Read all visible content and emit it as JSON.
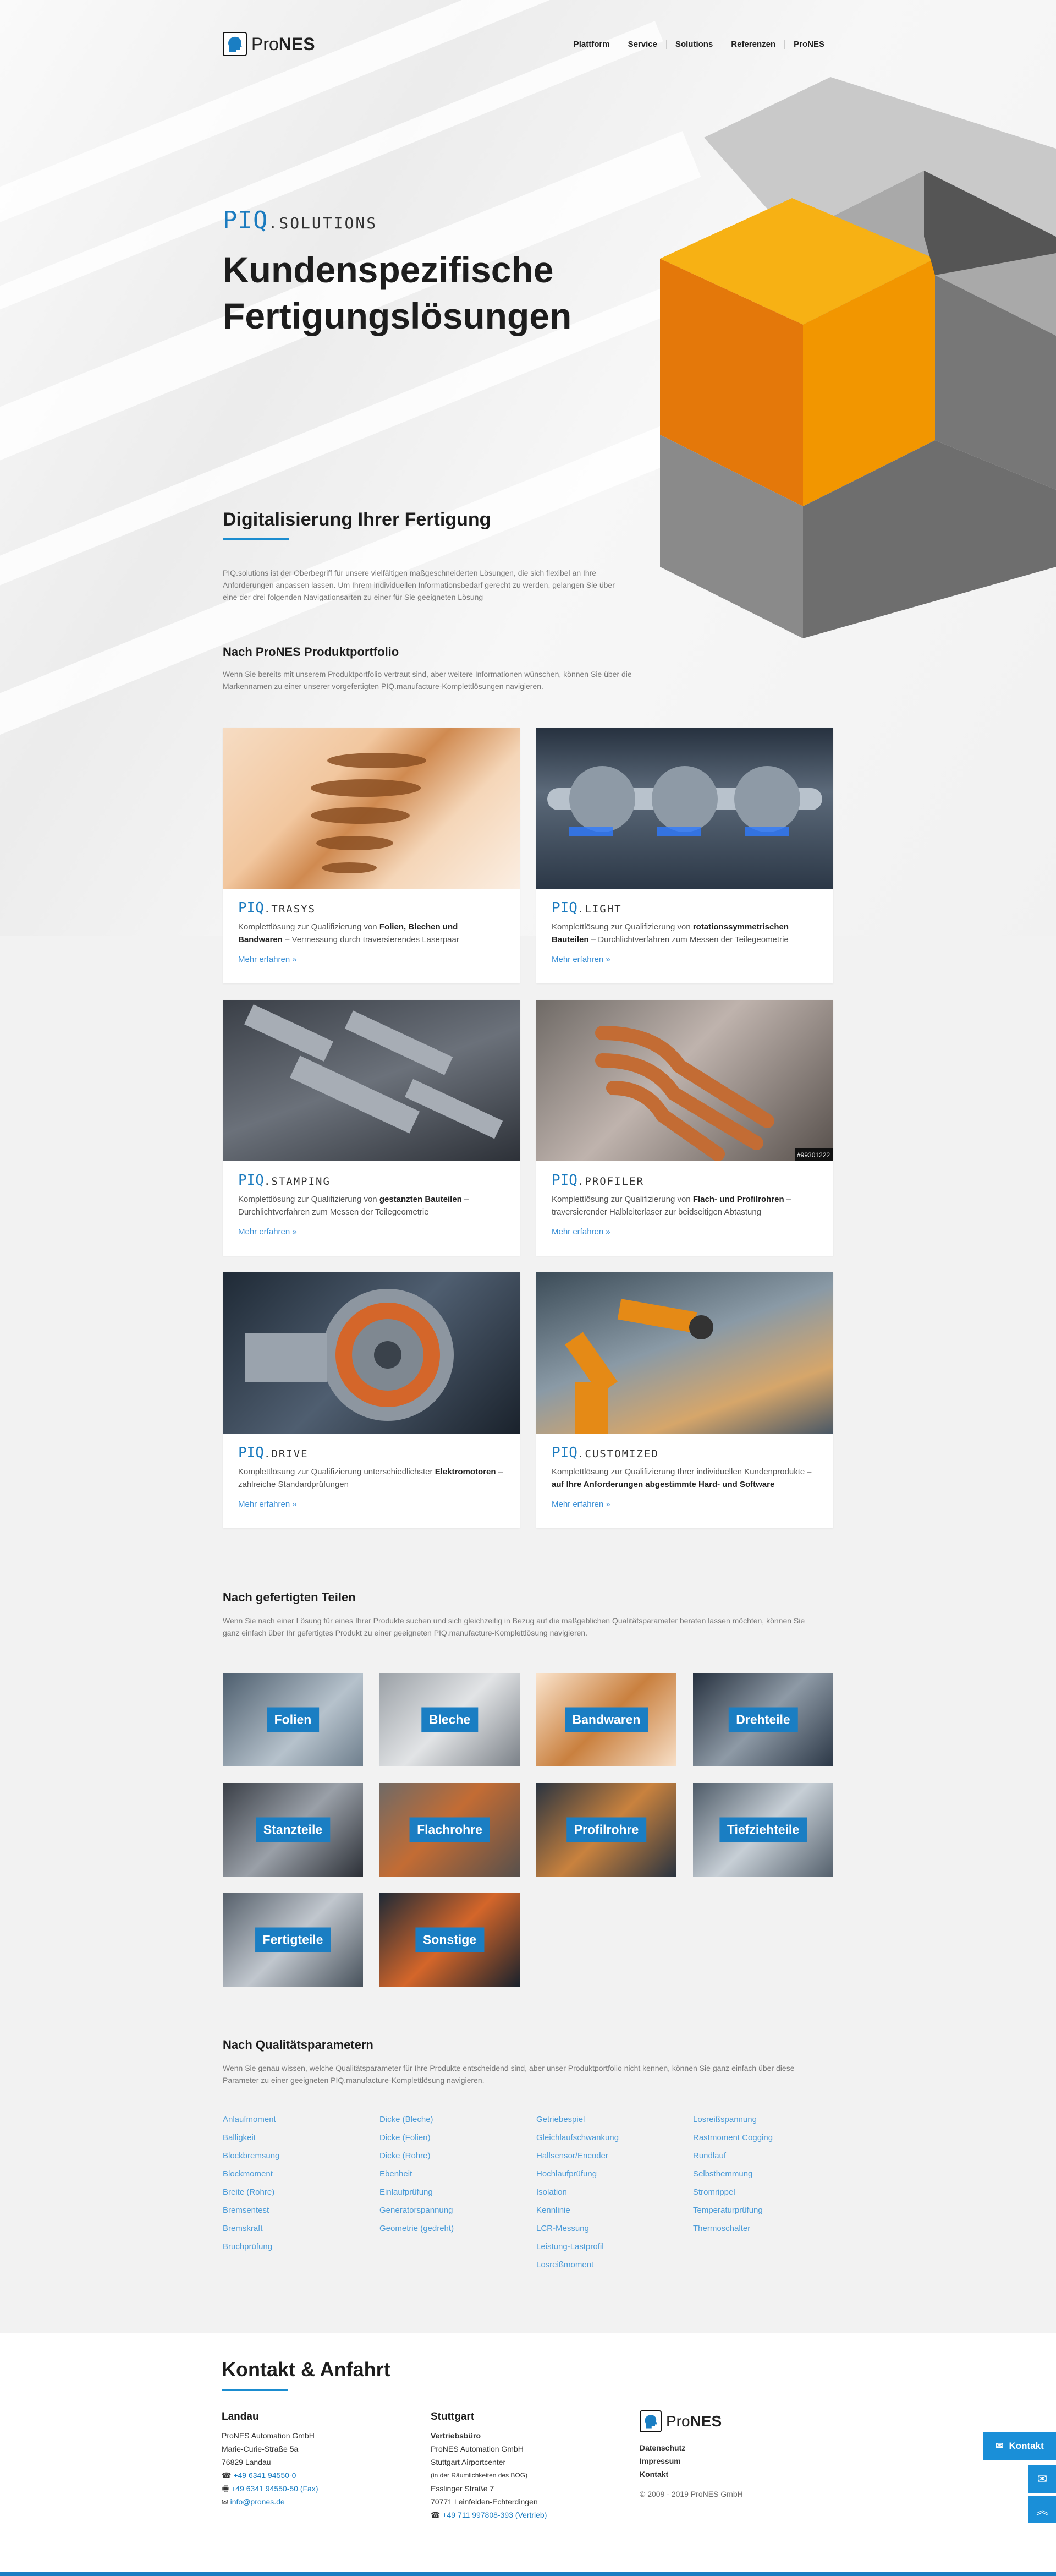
{
  "header": {
    "logo_prefix": "Pro",
    "logo_suffix": "NES",
    "nav": [
      "Plattform",
      "Service",
      "Solutions",
      "Referenzen",
      "ProNES"
    ]
  },
  "hero": {
    "brand_prefix": "PIQ",
    "brand_suffix": ".SOLUTIONS",
    "title_line1": "Kundenspezifische",
    "title_line2": "Fertigungslösungen"
  },
  "intro": {
    "heading": "Digitalisierung Ihrer Fertigung",
    "text": "PIQ.solutions ist der Oberbegriff für unsere vielfältigen maßgeschneiderten Lösungen, die sich flexibel an Ihre Anforderungen anpassen lassen. Um Ihrem individuellen Informationsbedarf gerecht zu werden, gelangen Sie über eine der drei folgenden Navigationsarten zu einer für Sie geeigneten Lösung"
  },
  "portfolio": {
    "heading": "Nach ProNES Produktportfolio",
    "text": "Wenn Sie bereits mit unserem Produktportfolio vertraut sind, aber weitere Informationen wünschen, können Sie über die Markennamen zu einer unserer vorgefertigten PIQ.manufacture-Komplettlösungen navigieren.",
    "link_label": "Mehr erfahren »",
    "cards": [
      {
        "prefix": "PIQ",
        "suffix": ".TRASYS",
        "desc_pre": "Komplettlösung zur Qualifizierung von ",
        "desc_bold": "Folien, Blechen und Bandwaren",
        "desc_post": " – Vermessung durch traversierendes Laserpaar"
      },
      {
        "prefix": "PIQ",
        "suffix": ".LIGHT",
        "desc_pre": "Komplettlösung zur Qualifizierung von ",
        "desc_bold": "rotationssymmetrischen Bauteilen",
        "desc_post": " – Durchlichtverfahren zum Messen der Teilegeometrie"
      },
      {
        "prefix": "PIQ",
        "suffix": ".STAMPING",
        "desc_pre": "Komplettlösung zur Qualifizierung von ",
        "desc_bold": "gestanzten Bauteilen",
        "desc_post": " – Durchlichtverfahren zum Messen der Teilegeometrie"
      },
      {
        "prefix": "PIQ",
        "suffix": ".PROFILER",
        "desc_pre": "Komplettlösung zur Qualifizierung von ",
        "desc_bold": "Flach- und Profilrohren",
        "desc_post": " – traversierender Halbleiterlaser zur beidseitigen Abtastung"
      },
      {
        "prefix": "PIQ",
        "suffix": ".DRIVE",
        "desc_pre": "Komplettlösung zur Qualifizierung unterschiedlichster ",
        "desc_bold": "Elektromotoren",
        "desc_post": " – zahlreiche Standardprüfungen"
      },
      {
        "prefix": "PIQ",
        "suffix": ".CUSTOMIZED",
        "desc_pre": "Komplettlösung zur Qualifizierung Ihrer individuellen Kundenprodukte ",
        "desc_bold": "– auf Ihre Anforderungen abgestimmte Hard- und Software",
        "desc_post": ""
      }
    ],
    "image_badge": "#99301222"
  },
  "parts": {
    "heading": "Nach gefertigten Teilen",
    "text": "Wenn Sie nach einer Lösung für eines Ihrer Produkte suchen und sich gleichzeitig in Bezug auf die maßgeblichen Qualitätsparameter beraten lassen möchten, können Sie ganz einfach über Ihr gefertigtes Produkt zu einer geeigneten PIQ.manufacture-Komplettlösung navigieren.",
    "tiles": [
      "Folien",
      "Bleche",
      "Bandwaren",
      "Drehteile",
      "Stanzteile",
      "Flachrohre",
      "Profilrohre",
      "Tiefziehteile",
      "Fertigteile",
      "Sonstige"
    ]
  },
  "quality": {
    "heading": "Nach Qualitätsparametern",
    "text": "Wenn Sie genau wissen, welche Qualitätsparameter für Ihre Produkte entscheidend sind, aber unser Produktportfolio nicht kennen, können Sie ganz einfach über diese Parameter zu einer geeigneten PIQ.manufacture-Komplettlösung navigieren.",
    "columns": [
      [
        "Anlaufmoment",
        "Balligkeit",
        "Blockbremsung",
        "Blockmoment",
        "Breite (Rohre)",
        "Bremsentest",
        "Bremskraft",
        "Bruchprüfung"
      ],
      [
        "Dicke (Bleche)",
        "Dicke (Folien)",
        "Dicke (Rohre)",
        "Ebenheit",
        "Einlaufprüfung",
        "Generatorspannung",
        "Geometrie (gedreht)"
      ],
      [
        "Getriebespiel",
        "Gleichlaufschwankung",
        "Hallsensor/Encoder",
        "Hochlaufprüfung",
        "Isolation",
        "Kennlinie",
        "LCR-Messung",
        "Leistung-Lastprofil",
        "Losreißmoment"
      ],
      [
        "Losreißspannung",
        "Rastmoment Cogging",
        "Rundlauf",
        "Selbsthemmung",
        "Stromrippel",
        "Temperaturprüfung",
        "Thermoschalter"
      ]
    ]
  },
  "footer": {
    "heading": "Kontakt & Anfahrt",
    "landau": {
      "title": "Landau",
      "lines": [
        "ProNES Automation GmbH",
        "Marie-Curie-Straße 5a",
        "76829 Landau"
      ],
      "phone": "+49 6341 94550-0",
      "fax": "+49 6341 94550-50 (Fax)",
      "email": "info@prones.de"
    },
    "stuttgart": {
      "title": "Stuttgart",
      "office": "Vertriebsbüro",
      "lines": [
        "ProNES Automation GmbH",
        "Stuttgart Airportcenter",
        "(in der Räumlichkeiten des BOG)",
        "Esslinger Straße 7",
        "70771 Leinfelden-Echterdingen"
      ],
      "phone": "+49 711 997808-393 (Vertrieb)"
    },
    "links": [
      "Datenschutz",
      "Impressum",
      "Kontakt"
    ],
    "copyright": "© 2009 - 2019 ProNES GmbH",
    "contact_tab": "Kontakt"
  },
  "colors": {
    "accent": "#1a7ec3",
    "orange": "#f28c00",
    "link": "#4b9bd8"
  }
}
